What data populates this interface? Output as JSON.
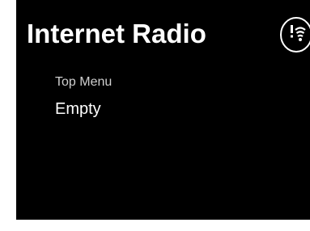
{
  "header": {
    "title": "Internet Radio",
    "status_icon": "wifi-warning-icon"
  },
  "menu": {
    "heading": "Top Menu",
    "items": [
      {
        "label": "Empty"
      }
    ]
  },
  "colors": {
    "background": "#000000",
    "text": "#ffffff",
    "heading_text": "#cfcfcf"
  }
}
